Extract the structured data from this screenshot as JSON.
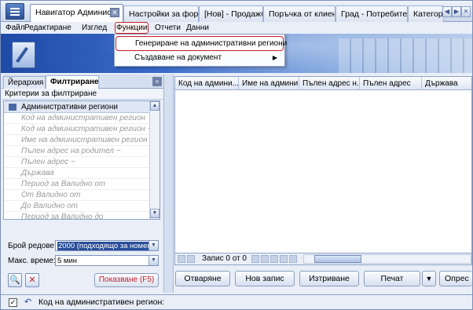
{
  "tabs": [
    {
      "label": "Навигатор Админис..."
    },
    {
      "label": "Настройки за форм..."
    },
    {
      "label": "[Нов] - Продажба"
    },
    {
      "label": "Поръчка от клиент..."
    },
    {
      "label": "Град - Потребител..."
    },
    {
      "label": "Категори"
    }
  ],
  "tab_close_glyph": "✕",
  "menu": {
    "file": "Файл",
    "edit": "Редактиране",
    "view": "Изглед",
    "functions": "Функции",
    "reports": "Отчети",
    "data": "Данни"
  },
  "dropdown": {
    "item1": "Генериране на административни региони",
    "item2": "Създаване на документ",
    "item2_arrow": "▶"
  },
  "left_panel": {
    "tab_hierarchy": "Йерархия",
    "tab_filter": "Филтриране",
    "criteria_label": "Критерии за филтриране",
    "group": "Административни региони",
    "criteria": [
      "Код на административен регион",
      "Код на административен регион ~",
      "Име на административен регион ~",
      "Пълен адрес на родител ~",
      "Пълен адрес ~",
      "Държава",
      "Период за Валидно от",
      "От Валидно от",
      "До Валидно от",
      "Период за Валидно до"
    ],
    "rows_label": "Брой редове:",
    "rows_value": "2000 (подходящо за номенк",
    "time_label": "Макс. време:",
    "time_value": "5 мин",
    "show_button": "Показване (F5)"
  },
  "grid": {
    "columns": [
      "Код на админи...",
      "Име на админи...",
      "Пълен адрес н...",
      "Пълен адрес",
      "Държава"
    ],
    "record_text": "Запис 0 от 0"
  },
  "actions": {
    "open": "Отваряне",
    "new": "Нов запис",
    "delete": "Изтриване",
    "print": "Печат",
    "more": "Опрес"
  },
  "status": {
    "text": "Код на административен регион:"
  },
  "colors": {
    "highlight": "#c81e2a",
    "accent": "#2b4f9a"
  }
}
